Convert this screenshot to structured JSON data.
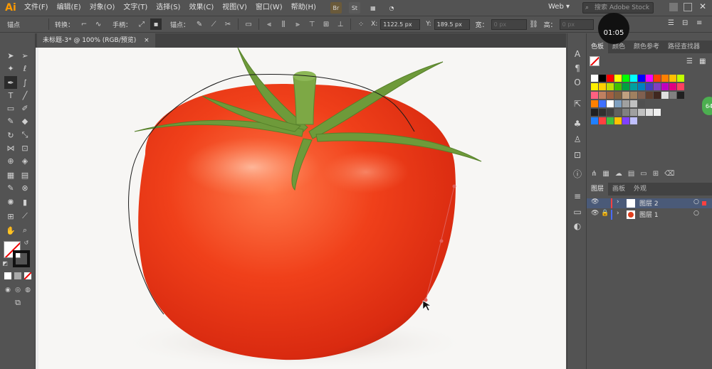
{
  "app": {
    "logo": "Ai"
  },
  "menu": [
    "文件(F)",
    "编辑(E)",
    "对象(O)",
    "文字(T)",
    "选择(S)",
    "效果(C)",
    "视图(V)",
    "窗口(W)",
    "帮助(H)"
  ],
  "menubar_right": {
    "bridge": "Br",
    "stock": "St",
    "workspace": "Web",
    "search_placeholder": "搜索 Adobe Stock"
  },
  "timer": "01:05",
  "control": {
    "anchor_label": "锚点",
    "convert_label": "转换：",
    "handles_label": "手柄：",
    "anchors_label": "锚点：",
    "x_label": "X:",
    "x_value": "1122.5 px",
    "y_label": "Y:",
    "y_value": "189.5 px",
    "w_label": "宽：",
    "w_value": "0 px",
    "h_label": "高：",
    "h_value": "0 px"
  },
  "document_tab": {
    "title": "未标题-3* @ 100% (RGB/预览)",
    "close": "×"
  },
  "swatches_panel": {
    "tabs": [
      "色板",
      "颜色",
      "颜色参考",
      "路径查找器"
    ]
  },
  "layers_panel": {
    "tabs": [
      "图层",
      "画板",
      "外观"
    ],
    "layers": [
      {
        "name": "图层 2",
        "color": "#ff4040"
      },
      {
        "name": "图层 1",
        "color": "#4a6cff"
      }
    ]
  },
  "side_badge": "64",
  "colors": {
    "accent": "#ff9a00",
    "panel_bg": "#535353",
    "dark_bg": "#424242",
    "tomato": "#e8401e",
    "stem": "#6e9a3a"
  }
}
